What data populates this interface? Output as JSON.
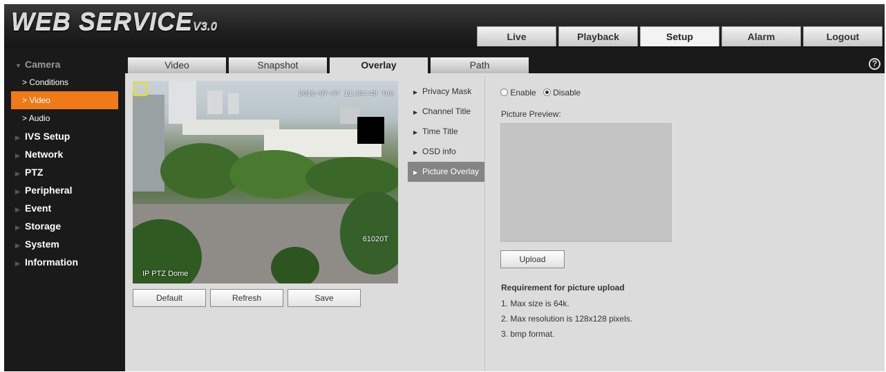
{
  "header": {
    "logo_text": "WEB SERVICE",
    "logo_version": "V3.0",
    "nav": [
      "Live",
      "Playback",
      "Setup",
      "Alarm",
      "Logout"
    ],
    "active_nav": "Setup"
  },
  "sidebar": {
    "camera": "Camera",
    "camera_items": [
      "Conditions",
      "Video",
      "Audio"
    ],
    "active_item": "Video",
    "sections": [
      "IVS Setup",
      "Network",
      "PTZ",
      "Peripheral",
      "Event",
      "Storage",
      "System",
      "Information"
    ]
  },
  "subtabs": [
    "Video",
    "Snapshot",
    "Overlay",
    "Path"
  ],
  "active_subtab": "Overlay",
  "help": "?",
  "video": {
    "timestamp": "2016-07-07 11:04:48 Tue",
    "channel_title": "IP PTZ Dome",
    "model": "61020T"
  },
  "buttons": {
    "default": "Default",
    "refresh": "Refresh",
    "save": "Save",
    "upload": "Upload"
  },
  "overlay_menu": [
    "Privacy Mask",
    "Channel Title",
    "Time Title",
    "OSD info",
    "Picture Overlay"
  ],
  "active_overlay": "Picture Overlay",
  "picture_overlay": {
    "enable_label": "Enable",
    "disable_label": "Disable",
    "selected": "Disable",
    "preview_label": "Picture Preview:",
    "requirement_title": "Requirement for picture upload",
    "requirements": [
      "1. Max size is 64k.",
      "2. Max resolution is 128x128 pixels.",
      "3. bmp format."
    ]
  }
}
